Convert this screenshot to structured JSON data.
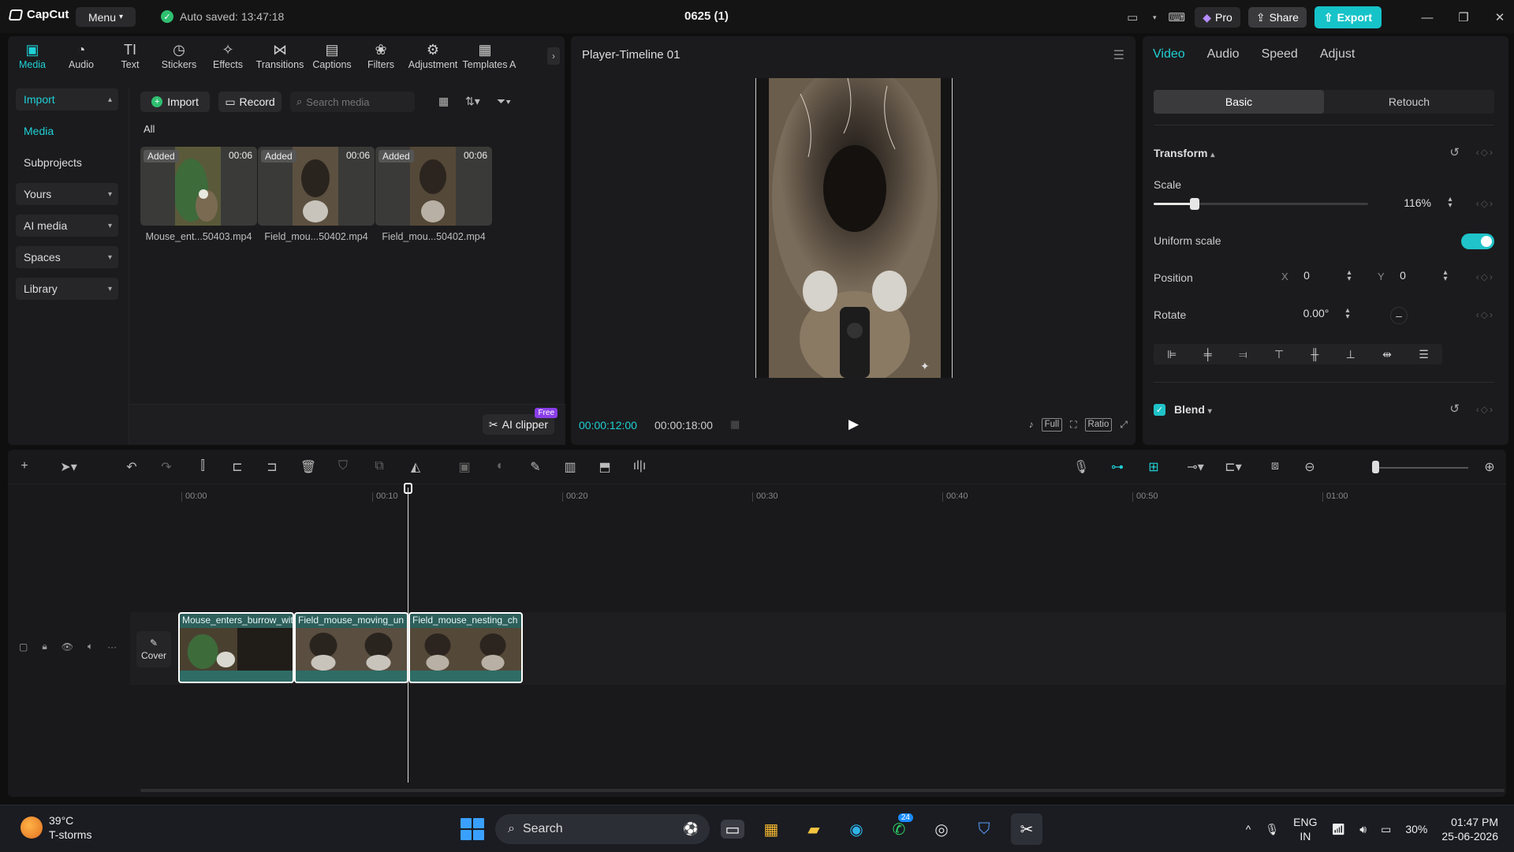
{
  "app": {
    "brand": "CapCut",
    "menu_label": "Menu",
    "autosave": "Auto saved: 13:47:18",
    "project_title": "0625 (1)",
    "pro_label": "Pro",
    "share_label": "Share",
    "export_label": "Export"
  },
  "tool_tabs": [
    {
      "label": "Media",
      "icon": "media-icon"
    },
    {
      "label": "Audio",
      "icon": "audio-icon"
    },
    {
      "label": "Text",
      "icon": "text-icon"
    },
    {
      "label": "Stickers",
      "icon": "stickers-icon"
    },
    {
      "label": "Effects",
      "icon": "effects-icon"
    },
    {
      "label": "Transitions",
      "icon": "transitions-icon"
    },
    {
      "label": "Captions",
      "icon": "captions-icon"
    },
    {
      "label": "Filters",
      "icon": "filters-icon"
    },
    {
      "label": "Adjustment",
      "icon": "adjustment-icon"
    },
    {
      "label": "Templates",
      "icon": "templates-icon"
    },
    {
      "label": "A",
      "icon": "more-icon"
    }
  ],
  "left_nav": {
    "import": "Import",
    "media": "Media",
    "subprojects": "Subprojects",
    "yours": "Yours",
    "ai_media": "AI media",
    "spaces": "Spaces",
    "library": "Library"
  },
  "media": {
    "import_label": "Import",
    "record_label": "Record",
    "search_placeholder": "Search media",
    "filter_all": "All",
    "ai_clipper_label": "AI clipper",
    "free_tag": "Free",
    "items": [
      {
        "status": "Added",
        "duration": "00:06",
        "name": "Mouse_ent...50403.mp4"
      },
      {
        "status": "Added",
        "duration": "00:06",
        "name": "Field_mou...50402.mp4"
      },
      {
        "status": "Added",
        "duration": "00:06",
        "name": "Field_mou...50402.mp4"
      }
    ]
  },
  "player": {
    "title": "Player-Timeline 01",
    "current_time": "00:00:12:00",
    "total_time": "00:00:18:00",
    "full_label": "Full",
    "ratio_label": "Ratio"
  },
  "props": {
    "tabs": [
      "Video",
      "Audio",
      "Speed",
      "Adjust"
    ],
    "subtabs": [
      "Basic",
      "Retouch"
    ],
    "transform_label": "Transform",
    "scale_label": "Scale",
    "scale_value": "116%",
    "scale_fraction": 0.19,
    "uniform_scale_label": "Uniform scale",
    "uniform_scale_on": true,
    "position_label": "Position",
    "x_label": "X",
    "x_value": "0",
    "y_label": "Y",
    "y_value": "0",
    "rotate_label": "Rotate",
    "rotate_value": "0.00°",
    "blend_label": "Blend"
  },
  "timeline": {
    "ticks": [
      "00:00",
      "00:10",
      "00:20",
      "00:30",
      "00:40",
      "00:50",
      "01:00"
    ],
    "cover_label": "Cover",
    "clips": [
      {
        "label": "Mouse_enters_burrow_with"
      },
      {
        "label": "Field_mouse_moving_un"
      },
      {
        "label": "Field_mouse_nesting_ch"
      }
    ]
  },
  "taskbar": {
    "temperature": "39°C",
    "weather": "T-storms",
    "search_label": "Search",
    "whatsapp_badge": "24",
    "lang": "ENG",
    "region": "IN",
    "battery": "30%",
    "time": "01:47 PM",
    "date": "25-06-2026"
  },
  "colors": {
    "accent": "#1fd0d6",
    "export": "#16c3c9",
    "panel": "#1b1b1d",
    "clip": "#2d5f5b"
  }
}
